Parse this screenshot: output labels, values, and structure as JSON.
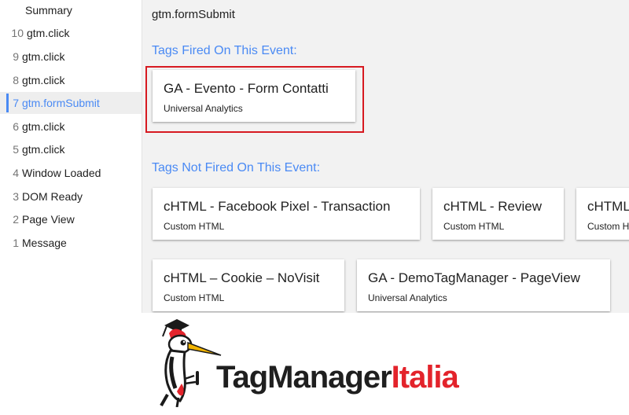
{
  "sidebar": {
    "summary": "Summary",
    "items": [
      {
        "num": "10",
        "label": "gtm.click"
      },
      {
        "num": "9",
        "label": "gtm.click"
      },
      {
        "num": "8",
        "label": "gtm.click"
      },
      {
        "num": "7",
        "label": "gtm.formSubmit",
        "active": true
      },
      {
        "num": "6",
        "label": "gtm.click"
      },
      {
        "num": "5",
        "label": "gtm.click"
      },
      {
        "num": "4",
        "label": "Window Loaded"
      },
      {
        "num": "3",
        "label": "DOM Ready"
      },
      {
        "num": "2",
        "label": "Page View"
      },
      {
        "num": "1",
        "label": "Message"
      }
    ]
  },
  "main": {
    "event_title": "gtm.formSubmit",
    "fired_title": "Tags Fired On This Event:",
    "not_fired_title": "Tags Not Fired On This Event:",
    "fired": [
      {
        "title": "GA - Evento - Form Contatti",
        "type": "Universal Analytics"
      }
    ],
    "not_fired": [
      {
        "title": "cHTML - Facebook Pixel - Transaction",
        "type": "Custom HTML"
      },
      {
        "title": "cHTML - Review",
        "type": "Custom HTML"
      },
      {
        "title": "cHTML - Cookie",
        "type": "Custom HTML"
      },
      {
        "title": "cHTML – Cookie – NoVisit",
        "type": "Custom HTML"
      },
      {
        "title": "GA - DemoTagManager - PageView",
        "type": "Universal Analytics"
      }
    ]
  },
  "brand": {
    "logo_part1": "TagManager",
    "logo_part2": "Italia",
    "colors": {
      "dark": "#1f1f1f",
      "red": "#e3232b"
    }
  },
  "colors": {
    "accent": "#4a8af4",
    "highlight": "#d71a21",
    "panel": "#f2f2f2"
  }
}
